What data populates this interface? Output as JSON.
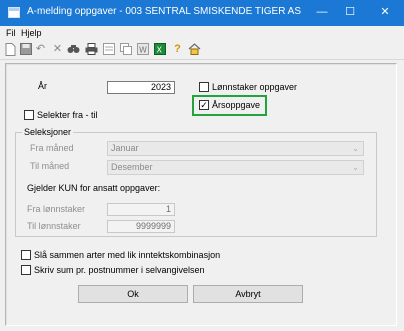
{
  "window": {
    "title": "A-melding oppgaver - 003 SENTRAL SMISKENDE TIGER AS",
    "controls": [
      "—",
      "☐",
      "✕"
    ]
  },
  "menu": [
    "Fil",
    "Hjelp"
  ],
  "toolbar_icons": [
    "new-icon",
    "save-icon",
    "undo-icon",
    "delete-icon",
    "find-icon",
    "print-icon",
    "preview-icon",
    "copy-icon",
    "export-word-icon",
    "export-excel-icon",
    "help-icon",
    "home-icon"
  ],
  "form": {
    "year_label": "År",
    "year_value": "2023",
    "lonnstaker_oppgaver": {
      "label": "Lønnstaker oppgaver",
      "checked": false
    },
    "arsoppgave": {
      "label": "Årsoppgave",
      "checked": true
    },
    "selekter_fra_til": {
      "label": "Selekter fra - til",
      "checked": false
    }
  },
  "seleksjoner": {
    "title": "Seleksjoner",
    "fra_maned_label": "Fra måned",
    "fra_maned_value": "Januar",
    "til_maned_label": "Til måned",
    "til_maned_value": "Desember",
    "gjelder_label": "Gjelder KUN for ansatt oppgaver:",
    "fra_lonnstaker_label": "Fra lønnstaker",
    "fra_lonnstaker_value": "1",
    "til_lonnstaker_label": "Til lønnstaker",
    "til_lonnstaker_value": "9999999"
  },
  "options": {
    "sla_sammen": {
      "label": "Slå sammen arter med lik inntektskombinasjon",
      "checked": false
    },
    "skriv_sum": {
      "label": "Skriv sum pr. postnummer i selvangivelsen",
      "checked": false
    }
  },
  "buttons": {
    "ok": "Ok",
    "cancel": "Avbryt"
  },
  "colors": {
    "titlebar": "#1b78d4",
    "highlight": "#23a33b"
  }
}
